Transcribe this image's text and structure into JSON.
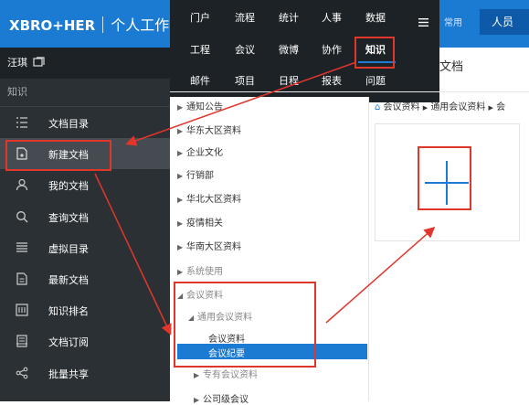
{
  "app": {
    "brand": "XBRO+HER",
    "title": "个人工作台"
  },
  "topbar": {
    "common_label": "常用",
    "user_label": "人员"
  },
  "top_menu": [
    [
      "门户",
      "流程",
      "统计",
      "人事",
      "数据"
    ],
    [
      "工程",
      "会议",
      "微博",
      "协作",
      "知识"
    ],
    [
      "邮件",
      "项目",
      "日程",
      "报表",
      "问题"
    ]
  ],
  "sidebar": {
    "user_name": "汪琪",
    "section": "知识",
    "items": [
      {
        "label": "文档目录",
        "icon": "list-icon"
      },
      {
        "label": "新建文档",
        "icon": "new-document-icon"
      },
      {
        "label": "我的文档",
        "icon": "user-icon"
      },
      {
        "label": "查询文档",
        "icon": "search-icon"
      },
      {
        "label": "虚拟目录",
        "icon": "list-lines-icon"
      },
      {
        "label": "最新文档",
        "icon": "document-icon"
      },
      {
        "label": "知识排名",
        "icon": "ranking-icon"
      },
      {
        "label": "文档订阅",
        "icon": "subscribe-icon"
      },
      {
        "label": "批量共享",
        "icon": "share-icon"
      }
    ]
  },
  "main": {
    "doc_title_partial": "文档",
    "breadcrumb": [
      "会议资料",
      "通用会议资料",
      "会"
    ]
  },
  "tree": [
    {
      "label": "通知公告",
      "level": 0,
      "open": false
    },
    {
      "label": "华东大区资料",
      "level": 0,
      "open": false
    },
    {
      "label": "企业文化",
      "level": 0,
      "open": false
    },
    {
      "label": "行销部",
      "level": 0,
      "open": false
    },
    {
      "label": "华北大区资料",
      "level": 0,
      "open": false
    },
    {
      "label": "疫情相关",
      "level": 0,
      "open": false
    },
    {
      "label": "华南大区资料",
      "level": 0,
      "open": false
    },
    {
      "label": "系统使用",
      "level": 0,
      "open": false,
      "muted": true
    },
    {
      "label": "会议资料",
      "level": 0,
      "open": true,
      "muted": true
    },
    {
      "label": "通用会议资料",
      "level": 1,
      "open": true,
      "muted": true
    },
    {
      "label": "会议资料",
      "level": 2
    },
    {
      "label": "会议纪要",
      "level": 2,
      "selected": true
    },
    {
      "label": "专有会议资料",
      "level": 1,
      "open": false,
      "muted": true
    },
    {
      "label": "公司级会议",
      "level": 0,
      "open": false
    }
  ],
  "colors": {
    "topbar": "#1b7ad2",
    "sidebar": "#2b3034",
    "accent": "#1b7ad2",
    "highlight": "#e0362c"
  }
}
